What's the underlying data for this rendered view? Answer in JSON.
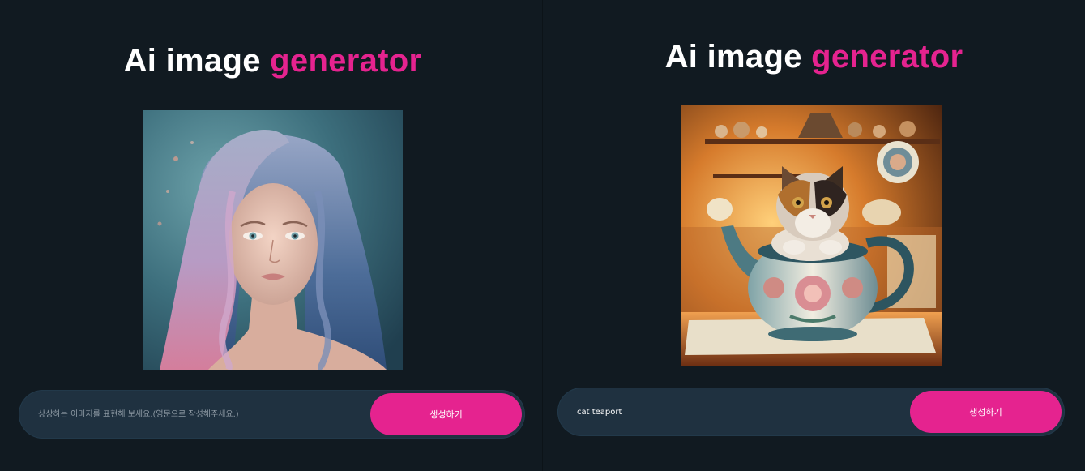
{
  "panels": [
    {
      "title_main": "Ai image ",
      "title_accent": "generator",
      "image_alt": "portrait of a young woman with long wavy silver and pink hair",
      "prompt_placeholder": "상상하는 이미지를 표현해 보세요.(영문으로 작성해주세요.)",
      "prompt_value": "",
      "generate_label": "생성하기"
    },
    {
      "title_main": "Ai image ",
      "title_accent": "generator",
      "image_alt": "fluffy cat sitting in a floral porcelain teapot in a warm kitchen",
      "prompt_placeholder": "",
      "prompt_value": "cat teaport",
      "generate_label": "생성하기"
    }
  ],
  "colors": {
    "background": "#111a21",
    "accent": "#e5238f",
    "input_bar": "#1f3140",
    "title_text": "#ffffff"
  }
}
